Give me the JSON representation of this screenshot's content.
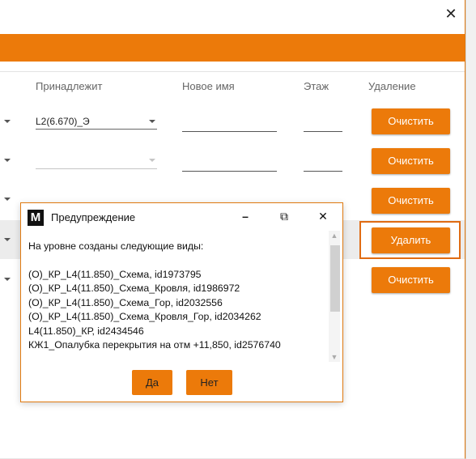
{
  "window": {
    "close_glyph": "✕"
  },
  "table": {
    "headers": [
      "Принадлежит",
      "Новое имя",
      "Этаж",
      "Удаление"
    ],
    "row1_combo_value": "L2(6.670)_Э",
    "clear_label": "Очистить",
    "delete_label": "Удалить"
  },
  "dialog": {
    "title": "Предупреждение",
    "logo_letter": "M",
    "minimize_glyph": "–",
    "restore_glyph": "⧉",
    "close_glyph": "✕",
    "intro": "На уровне созданы следующие виды:",
    "views": [
      "(О)_КР_L4(11.850)_Схема, id1973795",
      "(О)_КР_L4(11.850)_Схема_Кровля, id1986972",
      "(О)_КР_L4(11.850)_Схема_Гор, id2032556",
      "(О)_КР_L4(11.850)_Схема_Кровля_Гор, id2034262",
      "L4(11.850)_КР, id2434546",
      "КЖ1_Опалубка перекрытия на отм +11,850, id2576740"
    ],
    "yes_label": "Да",
    "no_label": "Нет"
  },
  "colors": {
    "accent": "#ec7a0a",
    "dialog_border": "#e07a10"
  }
}
